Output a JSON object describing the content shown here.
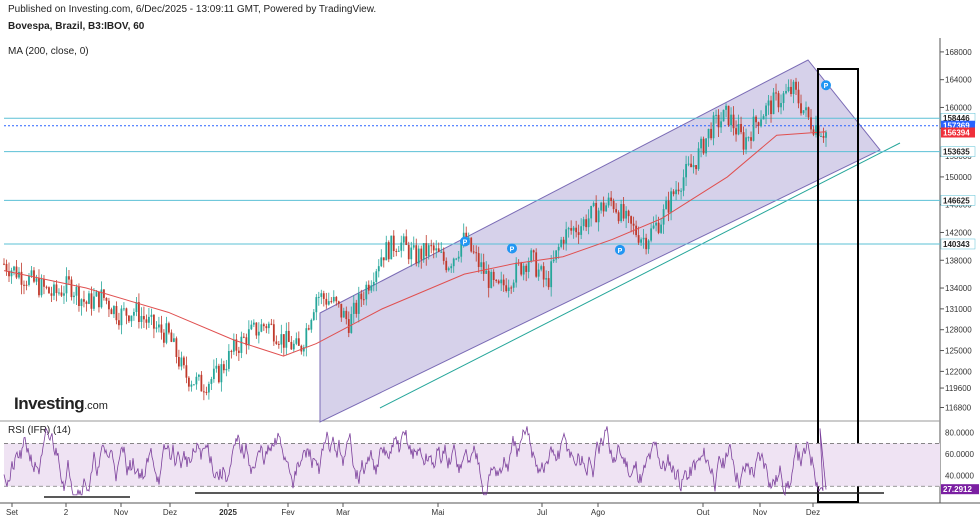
{
  "header": {
    "published": "Published on Investing.com, 6/Dec/2025 - 13:09:11 GMT, Powered by TradingView.",
    "symbol": "Bovespa, Brazil, B3:IBOV, 60",
    "ma_label": "MA (200, close, 0)"
  },
  "brand": {
    "name": "Investing",
    "suffix": ".com"
  },
  "colors": {
    "up": "#26a69a",
    "down": "#c0392b",
    "ma": "#e05050",
    "channel_fill": "#d6d1ea",
    "channel_edge": "#7a6bb5",
    "hline": "#5bc0d6",
    "rsi": "#7b3f9b",
    "rsi_band": "#efe3f3",
    "marker": "#2196f3",
    "box": "#000000",
    "badge_blue": "#2962ff",
    "badge_red": "#ef2f3a",
    "badge_white": "#ffffff",
    "badge_purple": "#7b1fa2"
  },
  "chart_data": [
    {
      "type": "line",
      "title": "Bovespa, Brazil, B3:IBOV, 60",
      "x_ticks": [
        "Set",
        "2",
        "Nov",
        "Dez",
        "2025",
        "Fev",
        "Mar",
        "Mai",
        "Jul",
        "Ago",
        "Out",
        "Nov",
        "Dez"
      ],
      "ylim": [
        115000,
        170000
      ],
      "y_ticks": [
        116800,
        119600,
        122000,
        125000,
        128000,
        131000,
        134000,
        138000,
        142000,
        146000,
        150000,
        153000,
        157000,
        160000,
        164000,
        168000
      ],
      "price_path": [
        [
          0,
          137500
        ],
        [
          0.02,
          136000
        ],
        [
          0.04,
          134500
        ],
        [
          0.06,
          133000
        ],
        [
          0.08,
          134500
        ],
        [
          0.1,
          131800
        ],
        [
          0.12,
          132800
        ],
        [
          0.14,
          130200
        ],
        [
          0.16,
          130800
        ],
        [
          0.18,
          128500
        ],
        [
          0.2,
          127200
        ],
        [
          0.22,
          121500
        ],
        [
          0.24,
          120000
        ],
        [
          0.26,
          121500
        ],
        [
          0.28,
          125200
        ],
        [
          0.3,
          127500
        ],
        [
          0.32,
          128900
        ],
        [
          0.34,
          126500
        ],
        [
          0.36,
          125000
        ],
        [
          0.38,
          133000
        ],
        [
          0.4,
          132000
        ],
        [
          0.42,
          129000
        ],
        [
          0.44,
          134000
        ],
        [
          0.46,
          139000
        ],
        [
          0.48,
          140700
        ],
        [
          0.5,
          138500
        ],
        [
          0.52,
          139500
        ],
        [
          0.54,
          137500
        ],
        [
          0.56,
          141000
        ],
        [
          0.58,
          137000
        ],
        [
          0.6,
          133500
        ],
        [
          0.62,
          136000
        ],
        [
          0.64,
          138500
        ],
        [
          0.66,
          134500
        ],
        [
          0.68,
          141500
        ],
        [
          0.7,
          143000
        ],
        [
          0.72,
          145000
        ],
        [
          0.74,
          146500
        ],
        [
          0.76,
          143000
        ],
        [
          0.78,
          141000
        ],
        [
          0.8,
          144000
        ],
        [
          0.82,
          149000
        ],
        [
          0.84,
          152000
        ],
        [
          0.86,
          157000
        ],
        [
          0.88,
          159000
        ],
        [
          0.9,
          155000
        ],
        [
          0.92,
          159000
        ],
        [
          0.94,
          161000
        ],
        [
          0.96,
          162500
        ],
        [
          0.98,
          158000
        ],
        [
          1.0,
          156394
        ]
      ],
      "ma_path": [
        [
          0,
          136500
        ],
        [
          0.1,
          134000
        ],
        [
          0.2,
          130500
        ],
        [
          0.28,
          126500
        ],
        [
          0.34,
          124200
        ],
        [
          0.38,
          126000
        ],
        [
          0.46,
          131000
        ],
        [
          0.56,
          136000
        ],
        [
          0.62,
          137500
        ],
        [
          0.68,
          138500
        ],
        [
          0.74,
          141000
        ],
        [
          0.8,
          144000
        ],
        [
          0.88,
          150000
        ],
        [
          0.94,
          156000
        ],
        [
          1.0,
          156500
        ]
      ],
      "horizontal_levels": [
        158446,
        157369,
        153635,
        146625,
        140343
      ],
      "price_badges": [
        {
          "label": "158446",
          "style": "white"
        },
        {
          "label": "157369",
          "style": "blue"
        },
        {
          "label": "156394",
          "style": "red"
        },
        {
          "label": "153635",
          "style": "white"
        },
        {
          "label": "146625",
          "style": "white"
        },
        {
          "label": "140343",
          "style": "white"
        }
      ],
      "markers": [
        {
          "label": "P"
        },
        {
          "label": "P"
        },
        {
          "label": "P"
        },
        {
          "label": "P"
        }
      ],
      "marker_y": [
        140700,
        139700,
        139500,
        163200
      ]
    },
    {
      "type": "line",
      "title": "RSI (IFR) (14)",
      "ylim": [
        20,
        90
      ],
      "y_ticks": [
        "80.0000",
        "60.0000",
        "40.0000"
      ],
      "last_value": "27.2912",
      "levels": [
        70,
        30
      ]
    }
  ]
}
